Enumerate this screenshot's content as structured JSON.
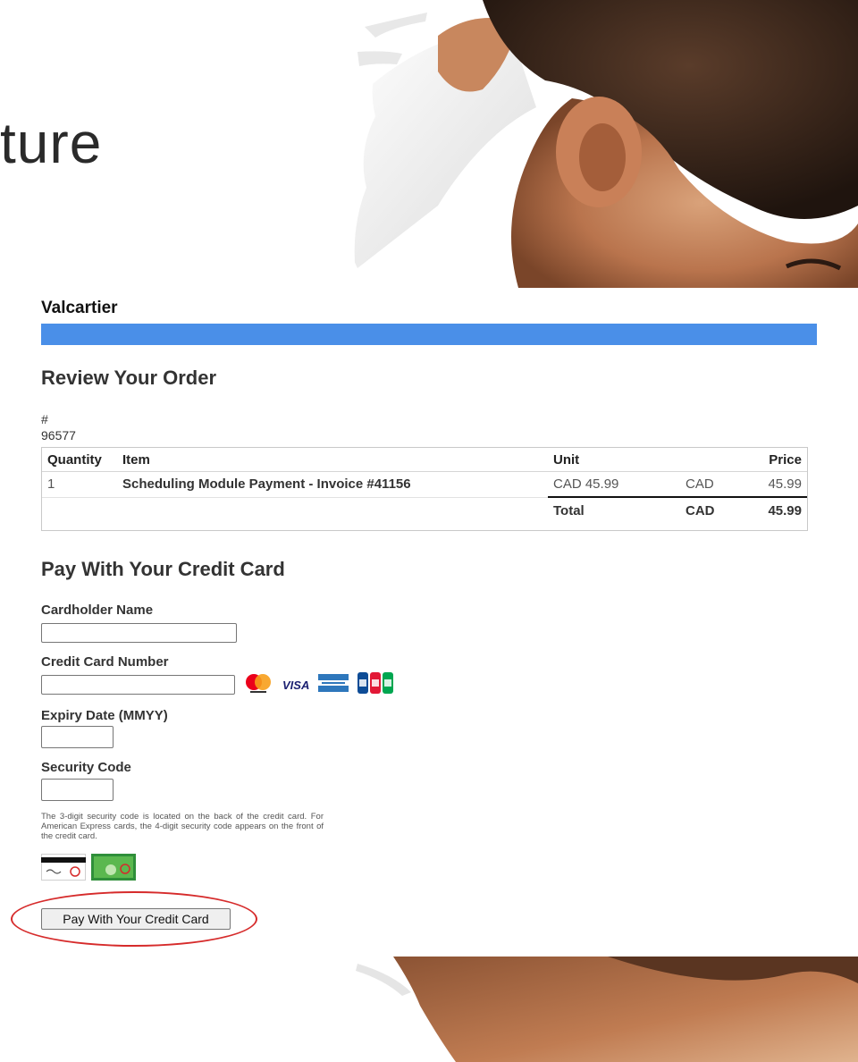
{
  "headline": "ture",
  "site_name": "Valcartier",
  "review": {
    "heading": "Review Your Order",
    "hash_label": "#",
    "order_number": "96577",
    "columns": [
      "Quantity",
      "Item",
      "Unit",
      "",
      "Price"
    ],
    "rows": [
      {
        "quantity": "1",
        "item": "Scheduling Module Payment - Invoice #41156",
        "unit": "CAD 45.99",
        "currency": "CAD",
        "price": "45.99"
      }
    ],
    "total": {
      "label": "Total",
      "currency": "CAD",
      "amount": "45.99"
    }
  },
  "payment": {
    "heading": "Pay With Your Credit Card",
    "cardholder_label": "Cardholder Name",
    "cardholder_value": "",
    "card_number_label": "Credit Card Number",
    "card_number_value": "",
    "expiry_label": "Expiry Date (MMYY)",
    "expiry_value": "",
    "security_label": "Security Code",
    "security_value": "",
    "security_note": "The 3-digit security code is located on the back of the credit card. For American Express cards, the 4-digit security code appears on the front of the credit card.",
    "card_logos": [
      "mastercard-icon",
      "visa-icon",
      "amex-icon",
      "jcb-icon"
    ],
    "visa_text": "VISA",
    "submit_label": "Pay With Your Credit Card"
  },
  "colors": {
    "accent_bar": "#4a8fe8",
    "highlight_ring": "#d62b2b"
  }
}
